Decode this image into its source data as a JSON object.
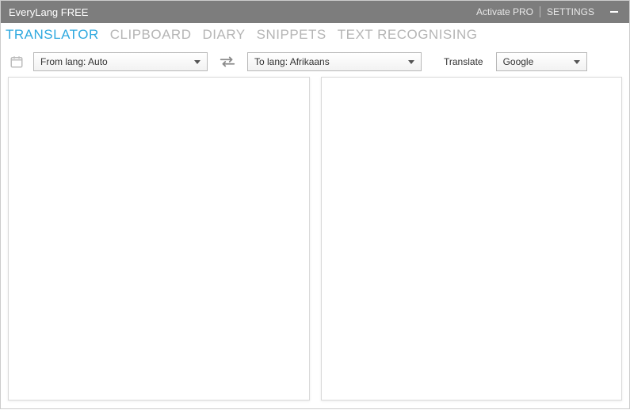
{
  "window": {
    "title": "EveryLang FREE",
    "activate_label": "Activate PRO",
    "settings_label": "SETTINGS"
  },
  "tabs": {
    "items": [
      {
        "label": "TRANSLATOR",
        "active": true
      },
      {
        "label": "CLIPBOARD",
        "active": false
      },
      {
        "label": "DIARY",
        "active": false
      },
      {
        "label": "SNIPPETS",
        "active": false
      },
      {
        "label": "TEXT RECOGNISING",
        "active": false
      }
    ]
  },
  "translator": {
    "from_lang_label": "From lang: Auto",
    "to_lang_label": "To lang: Afrikaans",
    "translate_label": "Translate",
    "engine_label": "Google",
    "source_text": "",
    "target_text": ""
  },
  "icons": {
    "calendar": "calendar-icon",
    "swap": "swap-icon",
    "caret": "chevron-down-icon",
    "minimize": "minimize-icon"
  }
}
